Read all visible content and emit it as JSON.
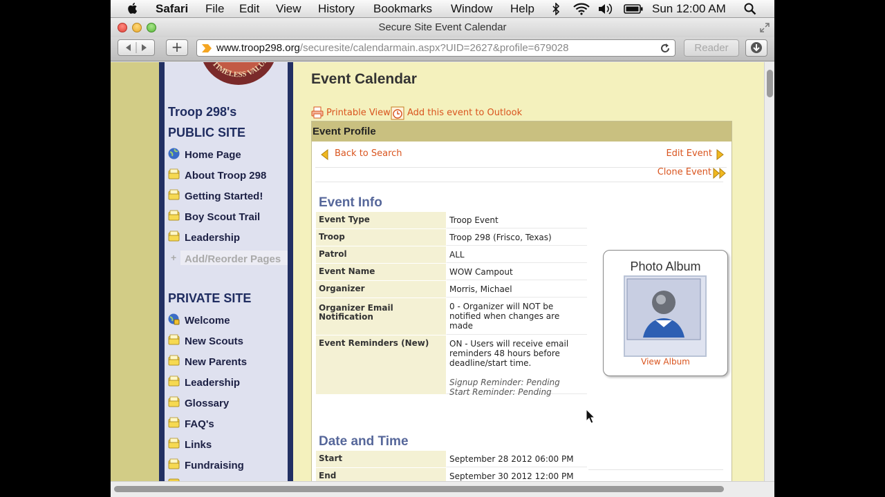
{
  "menubar": {
    "app": "Safari",
    "items": [
      "File",
      "Edit",
      "View",
      "History",
      "Bookmarks",
      "Window",
      "Help"
    ],
    "clock": "Sun 12:00 AM"
  },
  "window": {
    "title": "Secure Site Event Calendar"
  },
  "toolbar": {
    "url_host": "www.troop298.org",
    "url_path": "/securesite/calendarmain.aspx?UID=2627&profile=679028",
    "reader_label": "Reader",
    "add_label": "+"
  },
  "sidebar": {
    "public_heading_1": "Troop 298's",
    "public_heading_2": "PUBLIC SITE",
    "public_items": [
      {
        "label": "Home Page",
        "icon": "globe-icon"
      },
      {
        "label": "About Troop 298",
        "icon": "folder-icon"
      },
      {
        "label": "Getting Started!",
        "icon": "folder-icon"
      },
      {
        "label": "Boy Scout Trail",
        "icon": "folder-icon"
      },
      {
        "label": "Leadership",
        "icon": "folder-icon"
      }
    ],
    "add_reorder": "Add/Reorder Pages",
    "private_heading": "PRIVATE SITE",
    "private_items": [
      {
        "label": "Welcome",
        "icon": "globe-lock-icon"
      },
      {
        "label": "New Scouts",
        "icon": "folder-icon"
      },
      {
        "label": "New Parents",
        "icon": "folder-icon"
      },
      {
        "label": "Leadership",
        "icon": "folder-icon"
      },
      {
        "label": "Glossary",
        "icon": "folder-icon"
      },
      {
        "label": "FAQ's",
        "icon": "folder-icon"
      },
      {
        "label": "Links",
        "icon": "folder-icon"
      },
      {
        "label": "Fundraising",
        "icon": "folder-icon"
      }
    ]
  },
  "main": {
    "heading": "Event Calendar",
    "printable_view": "Printable View",
    "add_outlook": "Add this event to Outlook",
    "profile_bar": "Event Profile",
    "back_to_search": "Back to Search",
    "edit_event": "Edit Event",
    "clone_event": "Clone Event",
    "event_info_title": "Event Info",
    "event_info": [
      {
        "label": "Event Type",
        "value": "Troop Event"
      },
      {
        "label": "Troop",
        "value": "Troop 298 (Frisco, Texas)"
      },
      {
        "label": "Patrol",
        "value": "ALL"
      },
      {
        "label": "Event Name",
        "value": "WOW Campout"
      },
      {
        "label": "Organizer",
        "value": "Morris, Michael"
      },
      {
        "label": "Organizer Email Notification",
        "value": "0 - Organizer will NOT be notified when changes are made"
      },
      {
        "label": "Event Reminders (New)",
        "value": "ON - Users will receive email reminders 48 hours before deadline/start time.",
        "note1": "Signup Reminder: Pending",
        "note2": "Start Reminder: Pending"
      }
    ],
    "date_time_title": "Date and Time",
    "date_time": [
      {
        "label": "Start",
        "value": "September 28 2012 06:00 PM"
      },
      {
        "label": "End",
        "value": "September 30 2012 12:00 PM"
      }
    ],
    "album_title": "Photo Album",
    "view_album": "View Album"
  },
  "colors": {
    "page_bg": "#f4f1bd",
    "navy": "#223063",
    "link_orange": "#d9541e",
    "section_title": "#56679a",
    "profile_bar": "#c9c080"
  }
}
